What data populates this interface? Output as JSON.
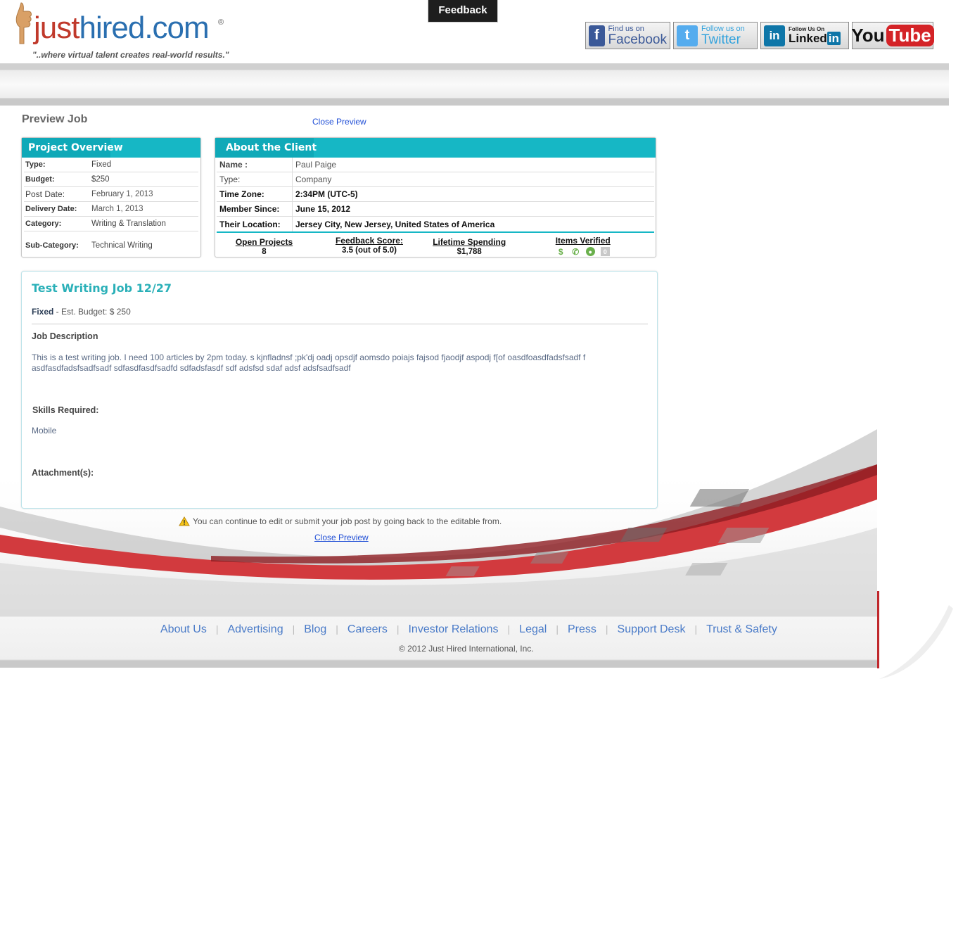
{
  "header": {
    "logo_just": "just",
    "logo_hired": "hired.com",
    "logo_registered": "®",
    "tagline": "\"..where virtual talent creates real-world results.\"",
    "feedback_tab": "Feedback",
    "social": {
      "facebook": {
        "small": "Find us on",
        "big": "Facebook"
      },
      "twitter": {
        "small": "Follow us on",
        "big": "Twitter"
      },
      "linkedin": {
        "small": "Follow Us On",
        "big": "Linked",
        "in": "in"
      },
      "youtube": {
        "you": "You",
        "tube": "Tube"
      }
    }
  },
  "page": {
    "title": "Preview Job",
    "close_preview": "Close Preview"
  },
  "project_overview": {
    "heading": "Project Overview",
    "rows": [
      {
        "key": "Type:",
        "value": "Fixed"
      },
      {
        "key": "Budget:",
        "value": "$250"
      },
      {
        "key": "Post Date:",
        "value": "February 1, 2013"
      },
      {
        "key": "Delivery Date:",
        "value": "March 1, 2013"
      },
      {
        "key": "Category:",
        "value": "Writing & Translation"
      },
      {
        "key": "Sub-Category:",
        "value": "Technical Writing"
      }
    ]
  },
  "about_client": {
    "heading": "About the Client",
    "rows": [
      {
        "key": "Name :",
        "value": "Paul Paige"
      },
      {
        "key": "Type:",
        "value": "Company"
      },
      {
        "key": "Time Zone:",
        "value": "2:34PM (UTC-5)"
      },
      {
        "key": "Member Since:",
        "value": "June 15, 2012"
      },
      {
        "key": "Their Location:",
        "value": "Jersey City, New Jersey, United States of America"
      }
    ],
    "stats": [
      {
        "label": "Open Projects",
        "value": "8"
      },
      {
        "label": "Feedback Score:",
        "value": "3.5 (out of 5.0)"
      },
      {
        "label": "Lifetime Spending",
        "value": "$1,788"
      },
      {
        "label": "Items Verified",
        "value": ""
      }
    ],
    "verified_icons": [
      "dollar-icon",
      "phone-icon",
      "globe-icon",
      "zero-badge"
    ],
    "verified_zero": "0"
  },
  "job": {
    "title": "Test Writing Job 12/27",
    "budget_type": "Fixed",
    "budget_text": " - Est. Budget: $ 250",
    "description_heading": "Job Description",
    "description": "This is a test writing job. I need 100 articles by 2pm today. s kjnfladnsf ;pk'dj oadj opsdjf aomsdo poiajs fajsod fjaodjf aspodj f[of oasdfoasdfadsfsadf f asdfasdfadsfsadfsadf sdfasdfasdfsadfd sdfadsfasdf sdf adsfsd sdaf adsf adsfsadfsadf",
    "skills_heading": "Skills Required:",
    "skills": "Mobile",
    "attachments_heading": "Attachment(s):"
  },
  "notice": {
    "text": "You can continue to edit or submit your job post by going back to the editable from.",
    "close_preview": "Close Preview"
  },
  "footer": {
    "links": [
      "About Us",
      "Advertising",
      "Blog",
      "Careers",
      "Investor Relations",
      "Legal",
      "Press",
      "Support Desk",
      "Trust & Safety"
    ],
    "copyright": "© 2012 Just Hired International, Inc."
  },
  "colors": {
    "accent_teal": "#16b7c5",
    "link_blue": "#1f4ed6",
    "footer_link": "#4a7bc8",
    "brand_red": "#c0392b",
    "brand_blue": "#2a6fb0"
  }
}
